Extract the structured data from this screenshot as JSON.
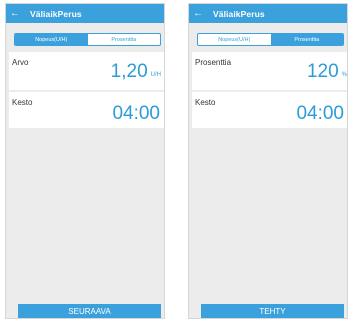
{
  "screens": [
    {
      "title": "VäliaikPerus",
      "back_icon": "←",
      "segments": [
        "Nopeus(U/H)",
        "Prosenttia"
      ],
      "active_segment": 0,
      "value_label": "Arvo",
      "value": "1,20",
      "value_unit": "U/H",
      "duration_label": "Kesto",
      "duration": "04:00",
      "action_label": "SEURAAVA"
    },
    {
      "title": "VäliaikPerus",
      "back_icon": "←",
      "segments": [
        "Nopeus(U/H)",
        "Prosenttia"
      ],
      "active_segment": 1,
      "value_label": "Prosenttia",
      "value": "120",
      "value_unit": "%",
      "duration_label": "Kesto",
      "duration": "04:00",
      "action_label": "TEHTY"
    }
  ],
  "colors": {
    "accent": "#3aa1dc",
    "value_text": "#2d9bd6",
    "background": "#ececec"
  }
}
